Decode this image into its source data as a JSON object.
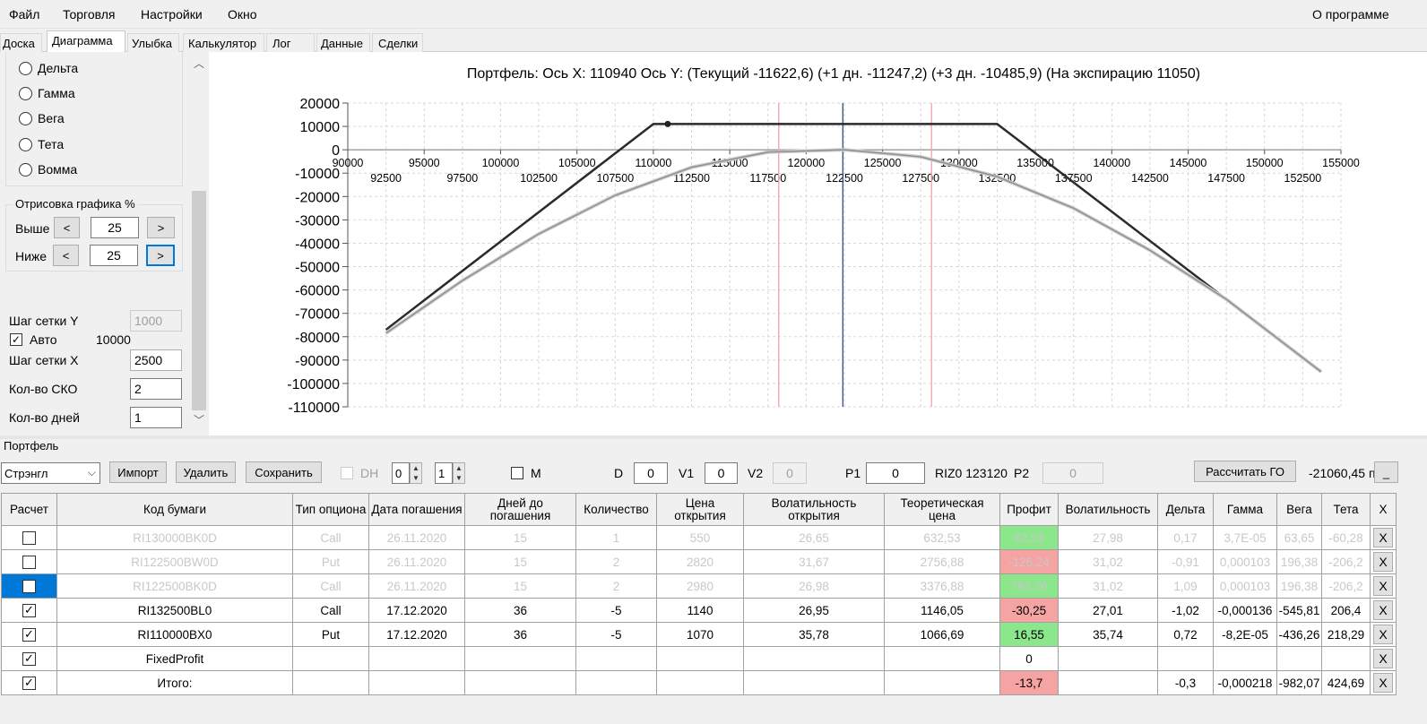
{
  "menu": {
    "file": "Файл",
    "trade": "Торговля",
    "settings": "Настройки",
    "window": "Окно",
    "about": "О программе"
  },
  "tabs": [
    "Доска",
    "Диаграмма",
    "Улыбка",
    "Калькулятор",
    "Лог",
    "Данные",
    "Сделки"
  ],
  "active_tab": "Диаграмма",
  "left_panel": {
    "radios": [
      "Дельта",
      "Гамма",
      "Вега",
      "Тета",
      "Вомма"
    ],
    "render_group_title": "Отрисовка графика %",
    "above_label": "Выше",
    "above_value": "25",
    "below_label": "Ниже",
    "below_value": "25",
    "prev_btn": "<",
    "next_btn": ">",
    "grid_y_label": "Шаг сетки Y",
    "grid_y_value": "1000",
    "auto_label": "Авто",
    "auto_checked": true,
    "auto_value": "10000",
    "grid_x_label": "Шаг сетки X",
    "grid_x_value": "2500",
    "sko_label": "Кол-во СКО",
    "sko_value": "2",
    "days_label": "Кол-во дней",
    "days_value": "1"
  },
  "chart_data": {
    "type": "line",
    "title": "Портфель: Ось X: 110940 Ось Y:  (Текущий -11622,6)  (+1 дн. -11247,2)  (+3 дн. -10485,9)  (На экспирацию 11050)",
    "xlim": [
      90000,
      155000
    ],
    "ylim": [
      -110000,
      20000
    ],
    "x_ticks_top": [
      "90000",
      "95000",
      "100000",
      "105000",
      "110000",
      "115000",
      "120000",
      "125000",
      "130000",
      "135000",
      "140000",
      "145000",
      "150000",
      "155000"
    ],
    "x_ticks_bottom": [
      "92500",
      "97500",
      "102500",
      "107500",
      "112500",
      "117500",
      "122500",
      "127500",
      "132500",
      "137500",
      "142500",
      "147500",
      "152500"
    ],
    "y_ticks": [
      "20000",
      "10000",
      "0",
      "-10000",
      "-20000",
      "-30000",
      "-40000",
      "-50000",
      "-60000",
      "-70000",
      "-80000",
      "-90000",
      "-100000",
      "-110000"
    ],
    "vlines_pink": [
      117500,
      127500
    ],
    "vline_blue": 122400,
    "series": [
      {
        "key": "expiry",
        "color": "#2b2b2b",
        "points": [
          [
            92500,
            -77000
          ],
          [
            110000,
            11050
          ],
          [
            132500,
            11050
          ],
          [
            153700,
            -95000
          ]
        ]
      },
      {
        "key": "current",
        "color": "#9a9a9a",
        "points": [
          [
            92500,
            -78500
          ],
          [
            97500,
            -56000
          ],
          [
            102500,
            -36000
          ],
          [
            107500,
            -19500
          ],
          [
            112500,
            -7500
          ],
          [
            117500,
            -1000
          ],
          [
            122500,
            0
          ],
          [
            127500,
            -3000
          ],
          [
            132500,
            -11500
          ],
          [
            137500,
            -25000
          ],
          [
            142500,
            -43000
          ],
          [
            147500,
            -64000
          ],
          [
            153700,
            -95000
          ]
        ]
      }
    ],
    "marker": {
      "x": 110940,
      "y": 11050
    }
  },
  "portfolio": {
    "title": "Портфель",
    "combo": "Стрэнгл",
    "import": "Импорт",
    "delete": "Удалить",
    "save": "Сохранить",
    "dh_label": "DH",
    "spin1": "0",
    "spin2": "1",
    "m_label": "M",
    "d_label": "D",
    "d_value": "0",
    "v1_label": "V1",
    "v1_value": "0",
    "v2_label": "V2",
    "v2_value": "0",
    "p1_label": "P1",
    "p1_value": "0",
    "riz_label": "RIZ0 123120",
    "p2_label": "P2",
    "p2_value": "0",
    "calc_go": "Рассчитать ГО",
    "go_value": "-21060,45 п",
    "min_btn": "_"
  },
  "table": {
    "headers": [
      "Расчет",
      "Код бумаги",
      "Тип опциона",
      "Дата погашения",
      "Дней до погашения",
      "Количество",
      "Цена открытия",
      "Волатильность открытия",
      "Теоретическая цена",
      "Профит",
      "Волатильность",
      "Дельта",
      "Гамма",
      "Вега",
      "Тета",
      "X"
    ],
    "rows": [
      {
        "dim": true,
        "checked": false,
        "selected": false,
        "code": "RI130000BK0D",
        "type": "Call",
        "date": "26.11.2020",
        "days": "15",
        "qty": "1",
        "price": "550",
        "vol_open": "26,65",
        "theo": "632,53",
        "profit": "82,53",
        "profit_color": "green",
        "vol": "27,98",
        "delta": "0,17",
        "gamma": "3,7E-05",
        "vega": "63,65",
        "theta": "-60,28"
      },
      {
        "dim": true,
        "checked": false,
        "selected": false,
        "code": "RI122500BW0D",
        "type": "Put",
        "date": "26.11.2020",
        "days": "15",
        "qty": "2",
        "price": "2820",
        "vol_open": "31,67",
        "theo": "2756,88",
        "profit": "-126,24",
        "profit_color": "pink",
        "vol": "31,02",
        "delta": "-0,91",
        "gamma": "0,000103",
        "vega": "196,38",
        "theta": "-206,2"
      },
      {
        "dim": true,
        "checked": false,
        "selected": true,
        "code": "RI122500BK0D",
        "type": "Call",
        "date": "26.11.2020",
        "days": "15",
        "qty": "2",
        "price": "2980",
        "vol_open": "26,98",
        "theo": "3376,88",
        "profit": "793,76",
        "profit_color": "green",
        "vol": "31,02",
        "delta": "1,09",
        "gamma": "0,000103",
        "vega": "196,38",
        "theta": "-206,2"
      },
      {
        "dim": false,
        "checked": true,
        "selected": false,
        "code": "RI132500BL0",
        "type": "Call",
        "date": "17.12.2020",
        "days": "36",
        "qty": "-5",
        "price": "1140",
        "vol_open": "26,95",
        "theo": "1146,05",
        "profit": "-30,25",
        "profit_color": "pink",
        "vol": "27,01",
        "delta": "-1,02",
        "gamma": "-0,000136",
        "vega": "-545,81",
        "theta": "206,4"
      },
      {
        "dim": false,
        "checked": true,
        "selected": false,
        "code": "RI110000BX0",
        "type": "Put",
        "date": "17.12.2020",
        "days": "36",
        "qty": "-5",
        "price": "1070",
        "vol_open": "35,78",
        "theo": "1066,69",
        "profit": "16,55",
        "profit_color": "green",
        "vol": "35,74",
        "delta": "0,72",
        "gamma": "-8,2E-05",
        "vega": "-436,26",
        "theta": "218,29"
      },
      {
        "dim": false,
        "checked": true,
        "selected": false,
        "code": "FixedProfit",
        "type": "",
        "date": "",
        "days": "",
        "qty": "",
        "price": "",
        "vol_open": "",
        "theo": "",
        "profit": "0",
        "profit_color": "",
        "vol": "",
        "delta": "",
        "gamma": "",
        "vega": "",
        "theta": ""
      },
      {
        "dim": false,
        "checked": true,
        "selected": false,
        "code": "Итого:",
        "type": "",
        "date": "",
        "days": "",
        "qty": "",
        "price": "",
        "vol_open": "",
        "theo": "",
        "profit": "-13,7",
        "profit_color": "pink",
        "vol": "",
        "delta": "-0,3",
        "gamma": "-0,000218",
        "vega": "-982,07",
        "theta": "424,69"
      }
    ],
    "x_label": "X"
  }
}
